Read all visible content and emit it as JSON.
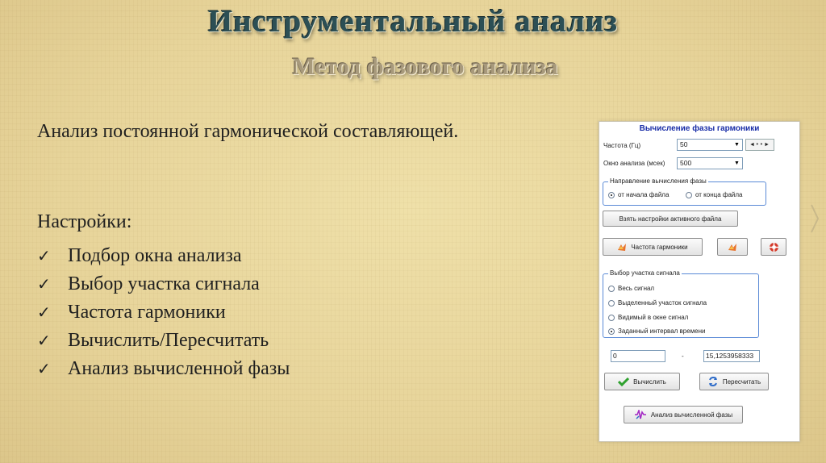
{
  "slide": {
    "title": "Инструментальный анализ",
    "subtitle": "Метод фазового анализа",
    "intro": "Анализ постоянной гармонической составляющей.",
    "settings_heading": "Настройки:",
    "checklist": [
      "Подбор окна анализа",
      "Выбор участка сигнала",
      "Частота гармоники",
      "Вычислить/Пересчитать",
      "Анализ вычисленной фазы"
    ]
  },
  "panel": {
    "title": "Вычисление фазы гармоники",
    "frequency_label": "Частота (Гц)",
    "frequency_value": "50",
    "window_label": "Окно анализа (мсек)",
    "window_value": "500",
    "spin_glyphs": "◄‣‣►",
    "direction_group": "Направление вычисления фазы",
    "direction_options": [
      "от начала файла",
      "от конца файла"
    ],
    "direction_selected": 0,
    "take_settings_button": "Взять настройки активного файла",
    "harmonic_frequency_button": "Частота гармоники",
    "segment_group": "Выбор участка сигнала",
    "segment_options": [
      "Весь сигнал",
      "Выделенный участок сигнала",
      "Видимый в окне сигнал",
      "Заданный интервал времени"
    ],
    "segment_selected": 3,
    "interval_from": "0",
    "interval_dash": "-",
    "interval_to": "15,1253958333",
    "calculate_button": "Вычислить",
    "recalculate_button": "Пересчитать",
    "analysis_button": "Анализ вычисленной фазы"
  },
  "colors": {
    "title": "#2c4f55",
    "panel_title": "#1a2ea8",
    "group_border": "#5a8ad6"
  }
}
